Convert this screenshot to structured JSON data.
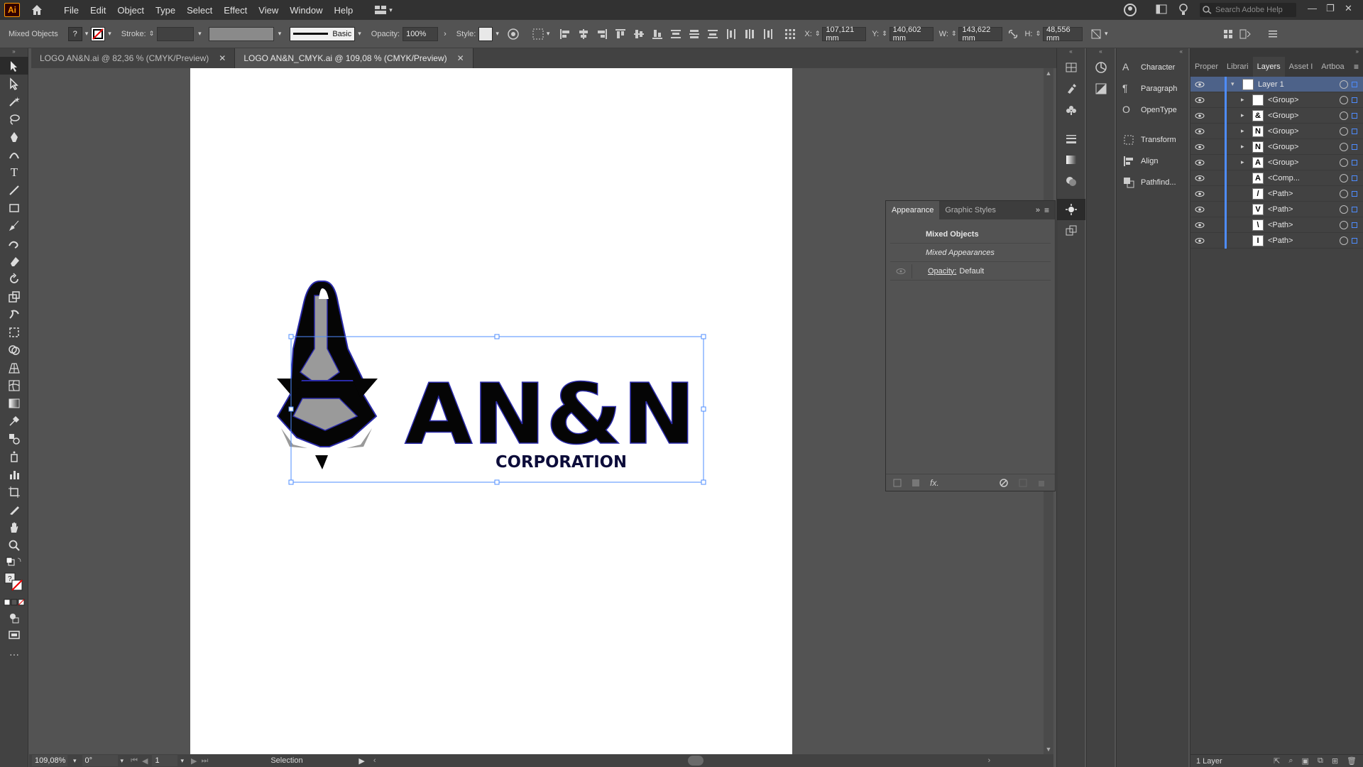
{
  "app": {
    "logo_text": "Ai"
  },
  "menu": [
    "File",
    "Edit",
    "Object",
    "Type",
    "Select",
    "Effect",
    "View",
    "Window",
    "Help"
  ],
  "search": {
    "placeholder": "Search Adobe Help"
  },
  "control_bar": {
    "selection_type": "Mixed Objects",
    "fill_value": "?",
    "stroke_label": "Stroke:",
    "brush_label": "Basic",
    "opacity_label": "Opacity:",
    "opacity_value": "100%",
    "style_label": "Style:",
    "x_label": "X:",
    "x_value": "107,121 mm",
    "y_label": "Y:",
    "y_value": "140,602 mm",
    "w_label": "W:",
    "w_value": "143,622 mm",
    "h_label": "H:",
    "h_value": "48,556 mm"
  },
  "doc_tabs": [
    {
      "title": "LOGO AN&N.ai @ 82,36 % (CMYK/Preview)",
      "active": false
    },
    {
      "title": "LOGO AN&N_CMYK.ai @ 109,08 % (CMYK/Preview)",
      "active": true
    }
  ],
  "logo": {
    "main_text": "AN&N",
    "sub_text": "CORPORATION"
  },
  "status_bar": {
    "zoom": "109,08%",
    "rotation": "0°",
    "artboard": "1",
    "tool": "Selection"
  },
  "panels_collapsed": [
    "Character",
    "Paragraph",
    "OpenType",
    "Transform",
    "Align",
    "Pathfind..."
  ],
  "layers_panel": {
    "tabs": [
      "Proper",
      "Librari",
      "Layers",
      "Asset I",
      "Artboa"
    ],
    "active_tab": "Layers",
    "rows": [
      {
        "name": "Layer 1",
        "thumb": "",
        "expand": "open",
        "top": true
      },
      {
        "name": "<Group>",
        "thumb": "",
        "expand": "closed"
      },
      {
        "name": "<Group>",
        "thumb": "&",
        "expand": "closed"
      },
      {
        "name": "<Group>",
        "thumb": "N",
        "expand": "closed"
      },
      {
        "name": "<Group>",
        "thumb": "N",
        "expand": "closed"
      },
      {
        "name": "<Group>",
        "thumb": "A",
        "expand": "closed"
      },
      {
        "name": "<Comp...",
        "thumb": "A",
        "expand": "none"
      },
      {
        "name": "<Path>",
        "thumb": "/",
        "expand": "none"
      },
      {
        "name": "<Path>",
        "thumb": "V",
        "expand": "none"
      },
      {
        "name": "<Path>",
        "thumb": "\\",
        "expand": "none"
      },
      {
        "name": "<Path>",
        "thumb": "I",
        "expand": "none"
      }
    ],
    "footer": "1 Layer"
  },
  "appearance_panel": {
    "tabs": [
      "Appearance",
      "Graphic Styles"
    ],
    "title": "Mixed Objects",
    "subtitle": "Mixed Appearances",
    "opacity_label": "Opacity:",
    "opacity_value": "Default",
    "fx_label": "fx."
  },
  "colors": {
    "accent": "#4e8cff",
    "layer_selected": "#4d6289",
    "ai_orange": "#ff9a00",
    "logo_blue": "#2a2aa8"
  }
}
